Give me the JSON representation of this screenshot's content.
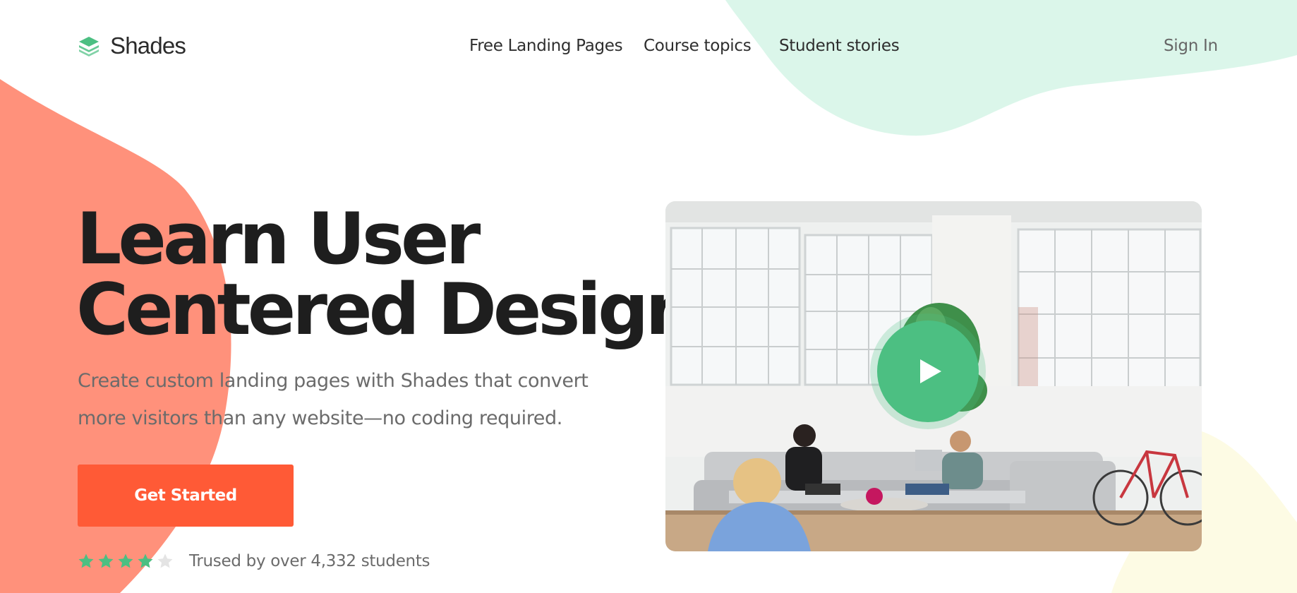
{
  "brand": {
    "name": "Shades",
    "logo_icon": "layers-icon",
    "accent": "#4cbf82"
  },
  "nav": {
    "links": [
      "Free Landing Pages",
      "Course topics",
      "Student stories"
    ],
    "sign_in": "Sign In"
  },
  "hero": {
    "title_line1": "Learn User",
    "title_line2": "Centered Design",
    "subtitle_line1": "Create custom landing pages with Shades that convert",
    "subtitle_line2": "more visitors than any website—no coding required.",
    "cta_label": "Get Started",
    "cta_color": "#ff5a36"
  },
  "rating": {
    "stars": 4,
    "max_stars": 5,
    "text": "Trused by over 4,332 students"
  },
  "media": {
    "play_icon": "play-icon",
    "image_icon": "office-photo"
  },
  "colors": {
    "coral_blob": "#ff917b",
    "mint_blob": "#dbf6ea",
    "cream_blob": "#fdfbe4",
    "star_filled": "#4cbf82",
    "star_empty": "#e4e4e4"
  }
}
